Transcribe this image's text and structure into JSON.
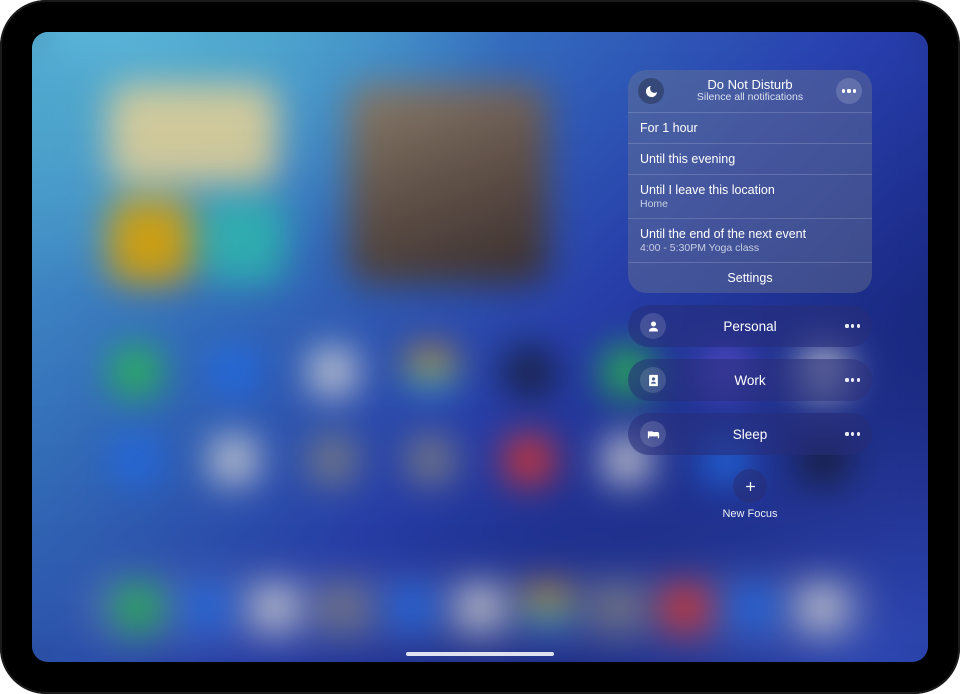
{
  "dnd": {
    "title": "Do Not Disturb",
    "subtitle": "Silence all notifications",
    "options": [
      {
        "label": "For 1 hour"
      },
      {
        "label": "Until this evening"
      },
      {
        "label": "Until I leave this location",
        "detail": "Home"
      },
      {
        "label": "Until the end of the next event",
        "detail": "4:00 - 5:30PM Yoga class"
      }
    ],
    "settings_label": "Settings"
  },
  "focus_modes": [
    {
      "name": "Personal",
      "icon": "person"
    },
    {
      "name": "Work",
      "icon": "badge"
    },
    {
      "name": "Sleep",
      "icon": "bed"
    }
  ],
  "new_focus_label": "New Focus"
}
